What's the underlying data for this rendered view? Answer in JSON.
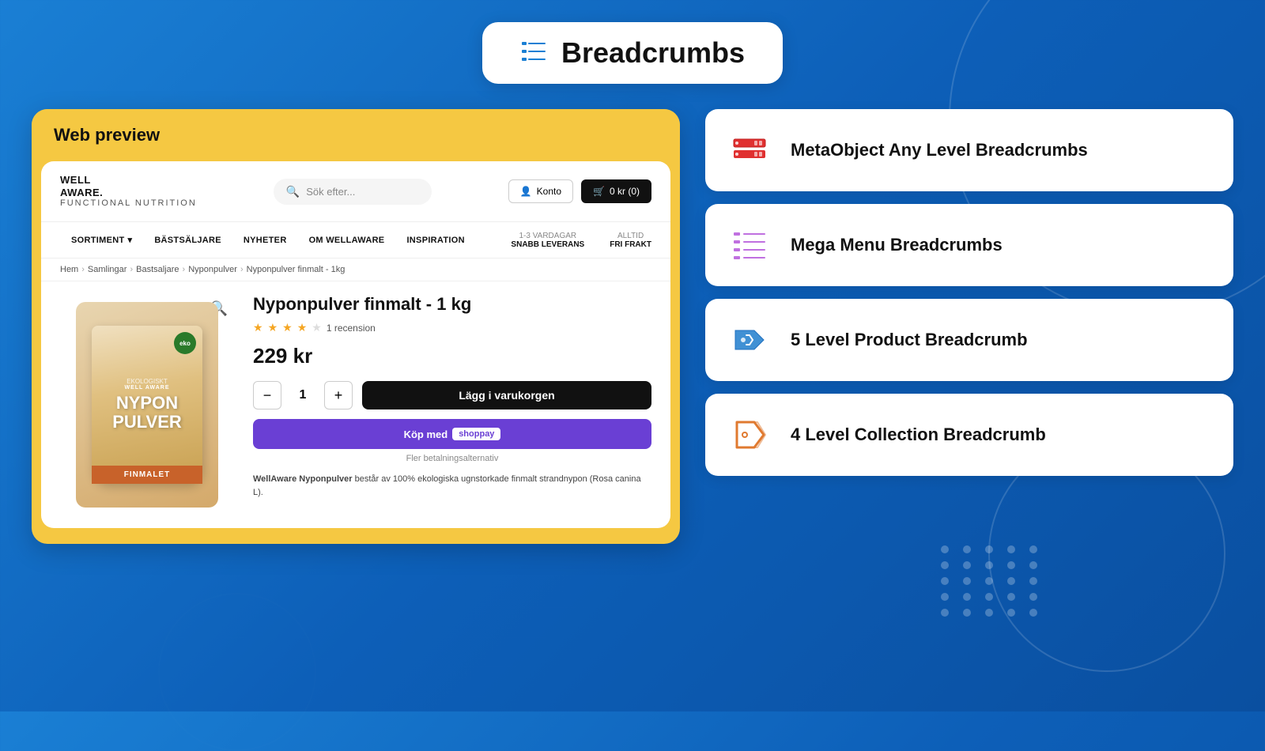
{
  "header": {
    "icon_label": "list-icon",
    "title": "Breadcrumbs"
  },
  "web_preview": {
    "title": "Web preview",
    "store": {
      "logo_line1": "WELL",
      "logo_line2": "AWARE.",
      "logo_tagline": "FUNCTIONAL NUTRITION",
      "search_placeholder": "Sök efter...",
      "btn_account": "Konto",
      "btn_cart": "0 kr  (0)",
      "nav_items": [
        {
          "label": "SORTIMENT",
          "has_arrow": true
        },
        {
          "label": "BÄSTSÄLJARE",
          "has_arrow": false
        },
        {
          "label": "NYHETER",
          "has_arrow": false
        },
        {
          "label": "OM WELLAWARE",
          "has_arrow": false
        },
        {
          "label": "INSPIRATION",
          "has_arrow": false
        }
      ],
      "delivery_label": "1-3 VARDAGAR",
      "delivery_value": "SNABB LEVERANS",
      "shipping_label": "ALLTID",
      "shipping_value": "FRI FRAKT",
      "breadcrumb": [
        "Hem",
        "Samlingar",
        "Bastsaljare",
        "Nyponpulver",
        "Nyponpulver finmalt - 1kg"
      ],
      "product": {
        "title": "Nyponpulver finmalt - 1 kg",
        "rating_count": "1 recension",
        "price": "229 kr",
        "qty": "1",
        "add_to_cart_label": "Lägg i varukorgen",
        "shop_pay_label": "Köp med",
        "shop_pay_brand": "ShopPay",
        "payment_alt": "Fler betalningsalternativ",
        "desc_bold": "WellAware Nyponpulver",
        "desc_text": " består av 100% ekologiska ugnstorkade finmalt strandnypon (Rosa canina L).",
        "bag_label_top": "EKOLOGISKT",
        "bag_label_main1": "NYPON",
        "bag_label_main2": "PULVER",
        "bag_label_sub": "FINMALET"
      }
    }
  },
  "sidebar": {
    "cards": [
      {
        "id": "metaobject",
        "icon": "server-icon",
        "icon_color": "red",
        "label": "MetaObject Any Level Breadcrumbs"
      },
      {
        "id": "mega-menu",
        "icon": "list-lines-icon",
        "icon_color": "purple",
        "label": "Mega Menu Breadcrumbs"
      },
      {
        "id": "5-level",
        "icon": "tag-back-icon",
        "icon_color": "blue",
        "label": "5 Level Product Breadcrumb"
      },
      {
        "id": "4-level",
        "icon": "tag-icon",
        "icon_color": "orange",
        "label": "4 Level Collection Breadcrumb"
      }
    ]
  }
}
